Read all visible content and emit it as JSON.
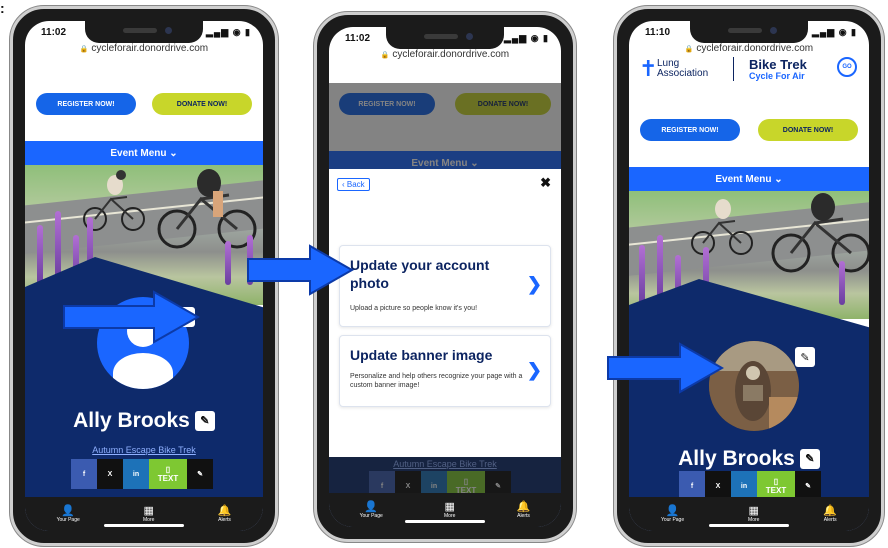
{
  "corner_mark": ":",
  "site": {
    "url": "cycleforair.donordrive.com",
    "register_label": "REGISTER NOW!",
    "donate_label": "DONATE NOW!",
    "event_menu_label": "Event Menu ⌄"
  },
  "colors": {
    "brand_blue": "#1a66ff",
    "navy": "#0e2a6b",
    "donate_green": "#c8d62a",
    "text_green": "#7ec832",
    "arrow_blue": "#1a66ff"
  },
  "profile": {
    "name": "Ally Brooks",
    "event_name": "Autumn Escape Bike Trek"
  },
  "share": {
    "facebook": "f",
    "x": "X",
    "linkedin": "in",
    "text_icon": "▯",
    "text_label": "TEXT",
    "link_icon": "✎"
  },
  "tabbar": {
    "your_page": "Your Page",
    "more": "More",
    "alerts": "Alerts"
  },
  "phones": [
    {
      "time": "11:02"
    },
    {
      "time": "11:02"
    },
    {
      "time": "11:10"
    }
  ],
  "modal": {
    "back_label": "Back",
    "close_icon": "✖",
    "options": [
      {
        "title": "Update your account photo",
        "description": "Upload a picture so people know it's you!"
      },
      {
        "title": "Update banner image",
        "description": "Personalize and help others recognize your page with a custom banner image!"
      }
    ]
  },
  "logos": {
    "lung_line1": "Lung",
    "lung_line2": "Association",
    "trek_title": "Bike Trek",
    "trek_subtitle": "Cycle For Air",
    "trek_badge": "GO"
  },
  "icons": {
    "status": "▂▄▆ ◉ ▮",
    "lock": "🔒",
    "pencil": "✎",
    "chevron_right": "❯",
    "user": "👤",
    "grid": "▦",
    "bell": "🔔"
  }
}
